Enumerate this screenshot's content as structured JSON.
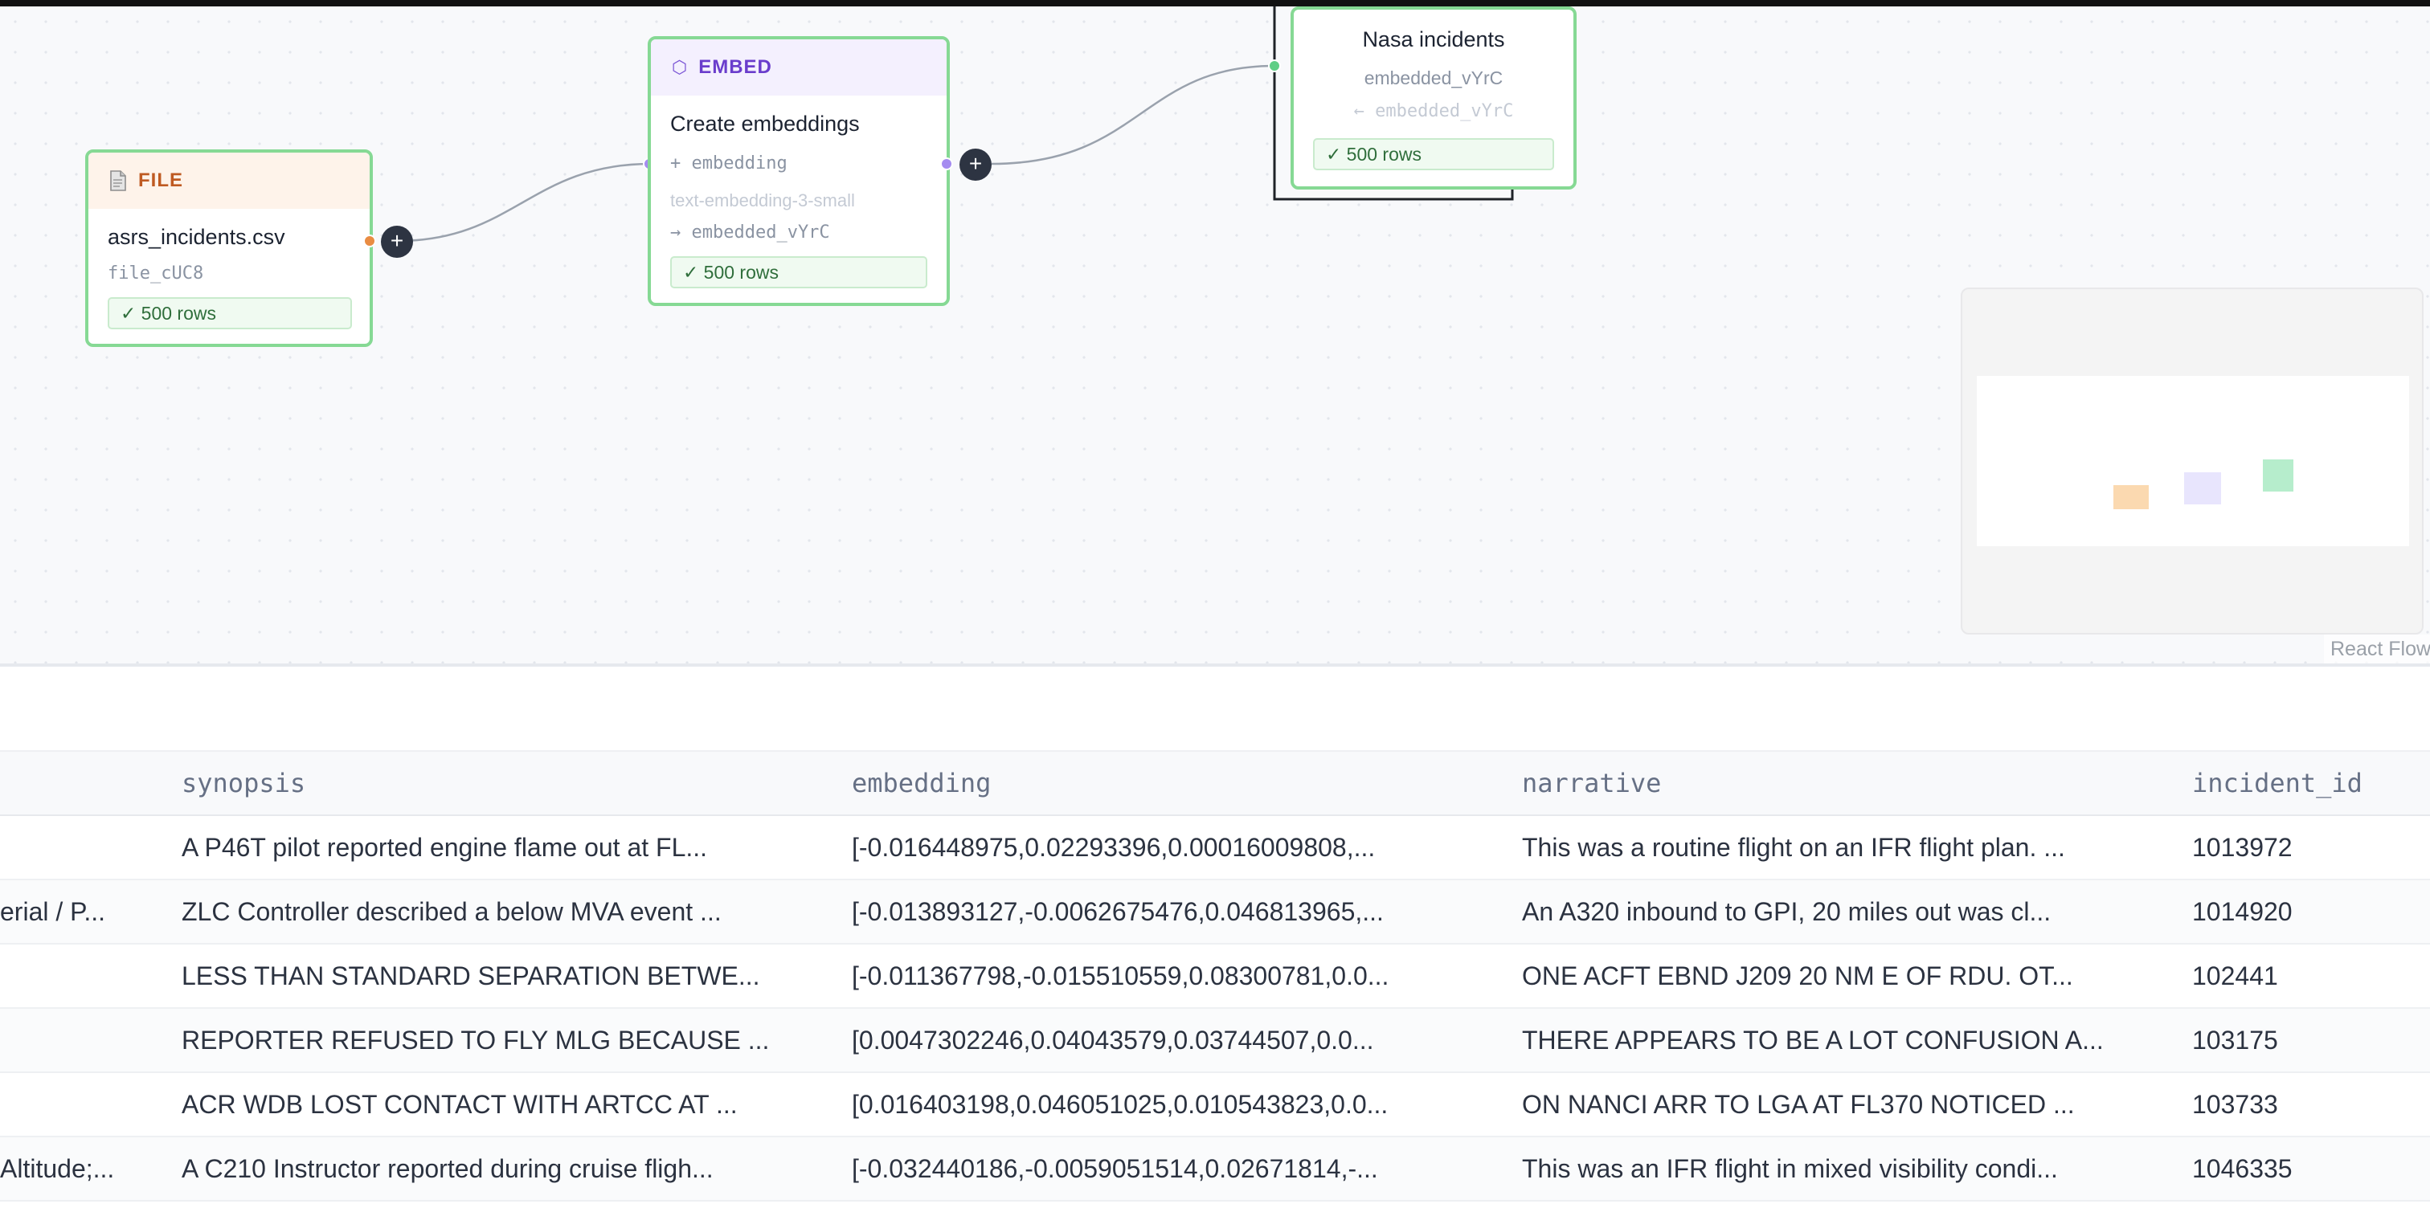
{
  "canvas": {
    "file_node": {
      "icon": "file-icon",
      "type_label": "FILE",
      "title": "asrs_incidents.csv",
      "id": "file_cUC8",
      "rows": "✓ 500 rows"
    },
    "embed_node": {
      "icon": "hexagon-icon",
      "type_label": "EMBED",
      "title": "Create embeddings",
      "column_added": "+ embedding",
      "model": "text-embedding-3-small",
      "output": "→ embedded_vYrC",
      "rows": "✓ 500 rows"
    },
    "output_node": {
      "title": "Nasa incidents",
      "source": "embedded_vYrC",
      "input": "← embedded_vYrC",
      "rows": "✓ 500 rows"
    },
    "add_button_label": "+",
    "attribution": "React Flow"
  },
  "colors": {
    "node_border": "#86d994",
    "file_accent": "#bf5a22",
    "embed_accent": "#6a3dcc",
    "success": "#2f6e3b",
    "handle_file": "#e98c42",
    "handle_embed": "#a58cf0",
    "handle_output": "#5fce86"
  },
  "table": {
    "columns": [
      "synopsis",
      "embedding",
      "narrative",
      "incident_id"
    ],
    "left_clipped": [
      "",
      "erial / P...",
      "",
      "",
      "",
      "Altitude;..."
    ],
    "rows": [
      [
        "A P46T pilot reported engine flame out at FL...",
        "[-0.016448975,0.02293396,0.00016009808,...",
        "This was a routine flight on an IFR flight plan. ...",
        "1013972"
      ],
      [
        "ZLC Controller described a below MVA event ...",
        "[-0.013893127,-0.0062675476,0.046813965,...",
        "An A320 inbound to GPI, 20 miles out was cl...",
        "1014920"
      ],
      [
        "LESS THAN STANDARD SEPARATION BETWE...",
        "[-0.011367798,-0.015510559,0.08300781,0.0...",
        "ONE ACFT EBND J209 20 NM E OF RDU. OT...",
        "102441"
      ],
      [
        "REPORTER REFUSED TO FLY MLG BECAUSE ...",
        "[0.0047302246,0.04043579,0.03744507,0.0...",
        "THERE APPEARS TO BE A LOT CONFUSION A...",
        "103175"
      ],
      [
        "ACR WDB LOST CONTACT WITH ARTCC AT ...",
        "[0.016403198,0.046051025,0.010543823,0.0...",
        "ON NANCI ARR TO LGA AT FL370 NOTICED ...",
        "103733"
      ],
      [
        "A C210 Instructor reported during cruise fligh...",
        "[-0.032440186,-0.0059051514,0.02671814,-...",
        "This was an IFR flight in mixed visibility condi...",
        "1046335"
      ]
    ]
  }
}
